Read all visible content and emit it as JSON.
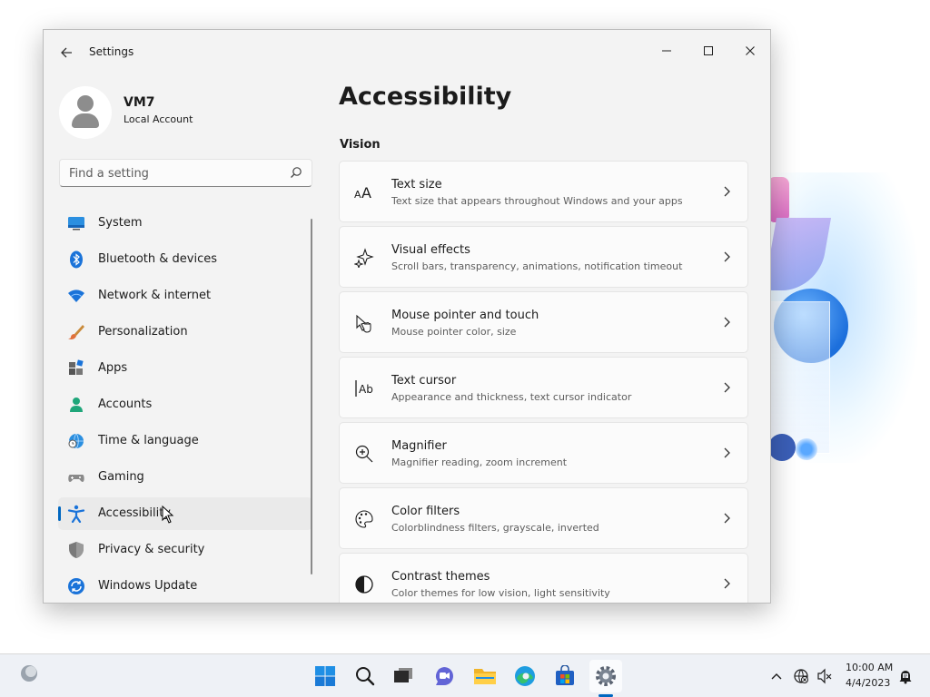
{
  "window": {
    "app_title": "Settings",
    "controls": {
      "minimize": "–",
      "maximize": "□",
      "close": "✕"
    }
  },
  "profile": {
    "name": "VM7",
    "account_type": "Local Account"
  },
  "search": {
    "placeholder": "Find a setting"
  },
  "nav": {
    "items": [
      {
        "label": "System",
        "icon": "system-icon",
        "selected": false
      },
      {
        "label": "Bluetooth & devices",
        "icon": "bluetooth-icon",
        "selected": false
      },
      {
        "label": "Network & internet",
        "icon": "wifi-icon",
        "selected": false
      },
      {
        "label": "Personalization",
        "icon": "brush-icon",
        "selected": false
      },
      {
        "label": "Apps",
        "icon": "apps-icon",
        "selected": false
      },
      {
        "label": "Accounts",
        "icon": "person-icon",
        "selected": false
      },
      {
        "label": "Time & language",
        "icon": "globe-clock-icon",
        "selected": false
      },
      {
        "label": "Gaming",
        "icon": "gamepad-icon",
        "selected": false
      },
      {
        "label": "Accessibility",
        "icon": "accessibility-icon",
        "selected": true
      },
      {
        "label": "Privacy & security",
        "icon": "shield-icon",
        "selected": false
      },
      {
        "label": "Windows Update",
        "icon": "update-icon",
        "selected": false
      }
    ]
  },
  "page": {
    "title": "Accessibility",
    "section": "Vision",
    "cards": [
      {
        "title": "Text size",
        "subtitle": "Text size that appears throughout Windows and your apps",
        "icon": "text-size-icon"
      },
      {
        "title": "Visual effects",
        "subtitle": "Scroll bars, transparency, animations, notification timeout",
        "icon": "sparkle-icon"
      },
      {
        "title": "Mouse pointer and touch",
        "subtitle": "Mouse pointer color, size",
        "icon": "pointer-icon"
      },
      {
        "title": "Text cursor",
        "subtitle": "Appearance and thickness, text cursor indicator",
        "icon": "text-cursor-icon"
      },
      {
        "title": "Magnifier",
        "subtitle": "Magnifier reading, zoom increment",
        "icon": "magnifier-icon"
      },
      {
        "title": "Color filters",
        "subtitle": "Colorblindness filters, grayscale, inverted",
        "icon": "palette-icon"
      },
      {
        "title": "Contrast themes",
        "subtitle": "Color themes for low vision, light sensitivity",
        "icon": "contrast-icon"
      }
    ]
  },
  "taskbar": {
    "apps": [
      "start-icon",
      "search-icon",
      "task-view-icon",
      "chat-icon",
      "file-explorer-icon",
      "edge-icon",
      "store-icon",
      "settings-icon"
    ],
    "active_app": "settings-icon",
    "clock": {
      "time": "10:00 AM",
      "date": "4/4/2023"
    }
  },
  "colors": {
    "accent": "#0067c0",
    "window_bg": "#f3f3f3",
    "card_bg": "#fbfbfb"
  }
}
